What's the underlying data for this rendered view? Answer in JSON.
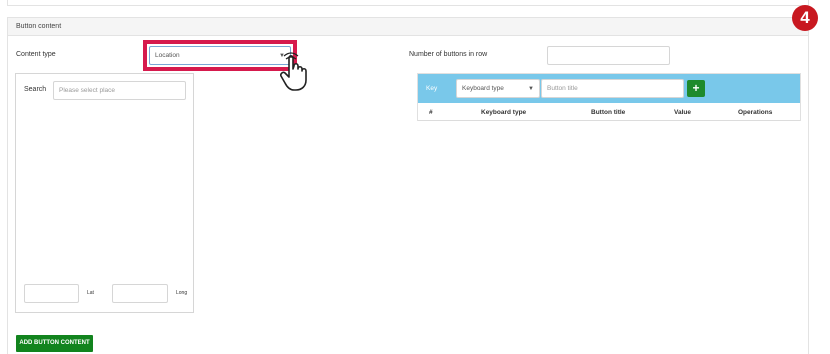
{
  "step_badge": "4",
  "panel": {
    "title": "Button content"
  },
  "content_type": {
    "label": "Content type",
    "value": "Location"
  },
  "map": {
    "search_label": "Search",
    "search_placeholder": "Please select place",
    "lat_label": "Lat",
    "long_label": "Long"
  },
  "buttons_in_row": {
    "label": "Number of buttons in row",
    "value": ""
  },
  "keyboard": {
    "key_label": "Key",
    "type_select": "Keyboard type",
    "title_placeholder": "Button title",
    "add_icon": "plus-icon",
    "columns": [
      "#",
      "Keyboard type",
      "Button title",
      "Value",
      "Operations"
    ]
  },
  "add_button_label": "ADD BUTTON CONTENT",
  "colors": {
    "accent_blue": "#79c8ea",
    "green": "#1e8a2c",
    "highlight": "#d61a4d",
    "badge": "#c81820"
  }
}
